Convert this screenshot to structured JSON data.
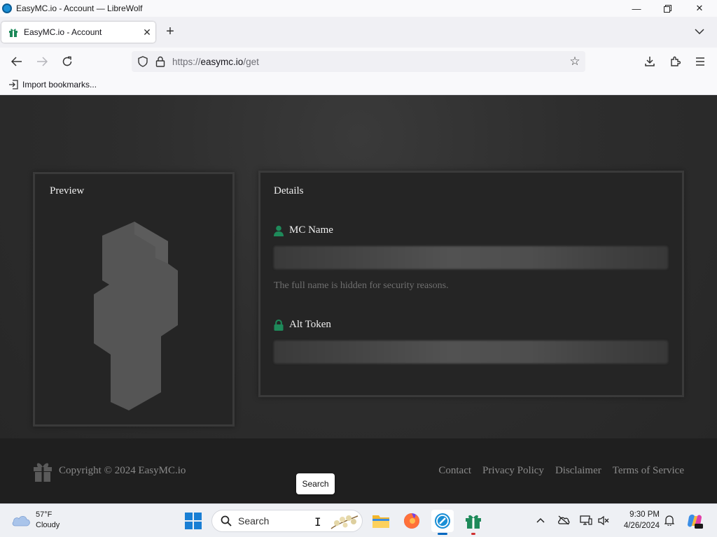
{
  "window": {
    "title": "EasyMC.io - Account — LibreWolf"
  },
  "tabs": [
    {
      "label": "EasyMC.io - Account"
    }
  ],
  "navbar": {
    "url_prefix": "https://",
    "url_host": "easymc.io",
    "url_path": "/get"
  },
  "bookmarks": {
    "import_label": "Import bookmarks..."
  },
  "preview": {
    "title": "Preview"
  },
  "details": {
    "title": "Details",
    "mc_name_label": "MC Name",
    "help_text": "The full name is hidden for security reasons.",
    "alt_token_label": "Alt Token"
  },
  "footer": {
    "copyright": "Copyright © 2024 EasyMC.io",
    "links": [
      "Contact",
      "Privacy Policy",
      "Disclaimer",
      "Terms of Service"
    ]
  },
  "tooltip": {
    "text": "Search"
  },
  "taskbar": {
    "weather_temp": "57°F",
    "weather_desc": "Cloudy",
    "search_label": "Search",
    "time": "9:30 PM",
    "date": "4/26/2024"
  },
  "colors": {
    "accent_green": "#1e8a5a",
    "card_bg": "#252525",
    "page_bg": "#2b2b2b"
  }
}
